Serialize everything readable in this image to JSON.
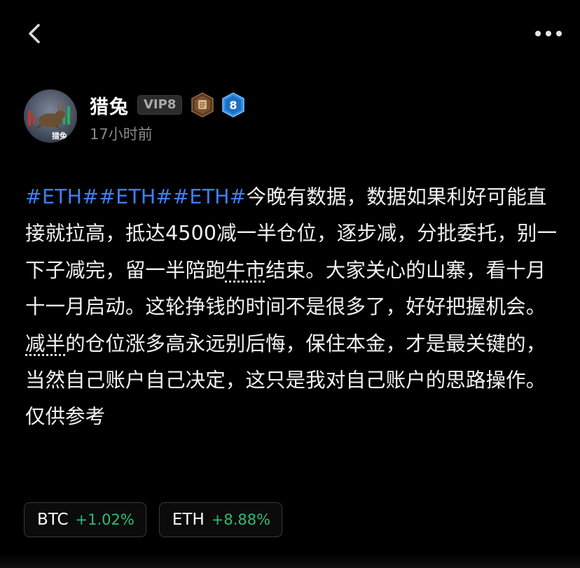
{
  "nav": {
    "back_icon": "chevron-left-icon",
    "more_icon": "more-horizontal-icon"
  },
  "author": {
    "name": "猎兔",
    "vip_label": "VIP8",
    "level_number": "8",
    "time_ago": "17小时前",
    "avatar_caption": "猎兔"
  },
  "post": {
    "hashtags": [
      "#ETH#",
      "#ETH#",
      "#ETH#"
    ],
    "segments": {
      "s1": "今晚有数据，数据如果利好可能直接就拉高，抵达4500减一半仓位，逐步减，分批委托，别一下子减完，留一半陪跑",
      "term1": "牛市",
      "s2": "结束。大家关心的山寨，看十月十一月启动。这轮挣钱的时间不是很多了，好好把握机会。",
      "term2": "减半",
      "s3": "的仓位涨多高永远别后悔，保住本金，才是最关键的，当然自己账户自己决定，这只是我对自己账户的思路操作。仅供参考"
    }
  },
  "tickers": [
    {
      "symbol": "BTC",
      "change": "+1.02%"
    },
    {
      "symbol": "ETH",
      "change": "+8.88%"
    }
  ],
  "colors": {
    "background": "#000000",
    "hashtag": "#3f7ff5",
    "positive": "#2ebd72",
    "muted_text": "#8a8a8a"
  }
}
